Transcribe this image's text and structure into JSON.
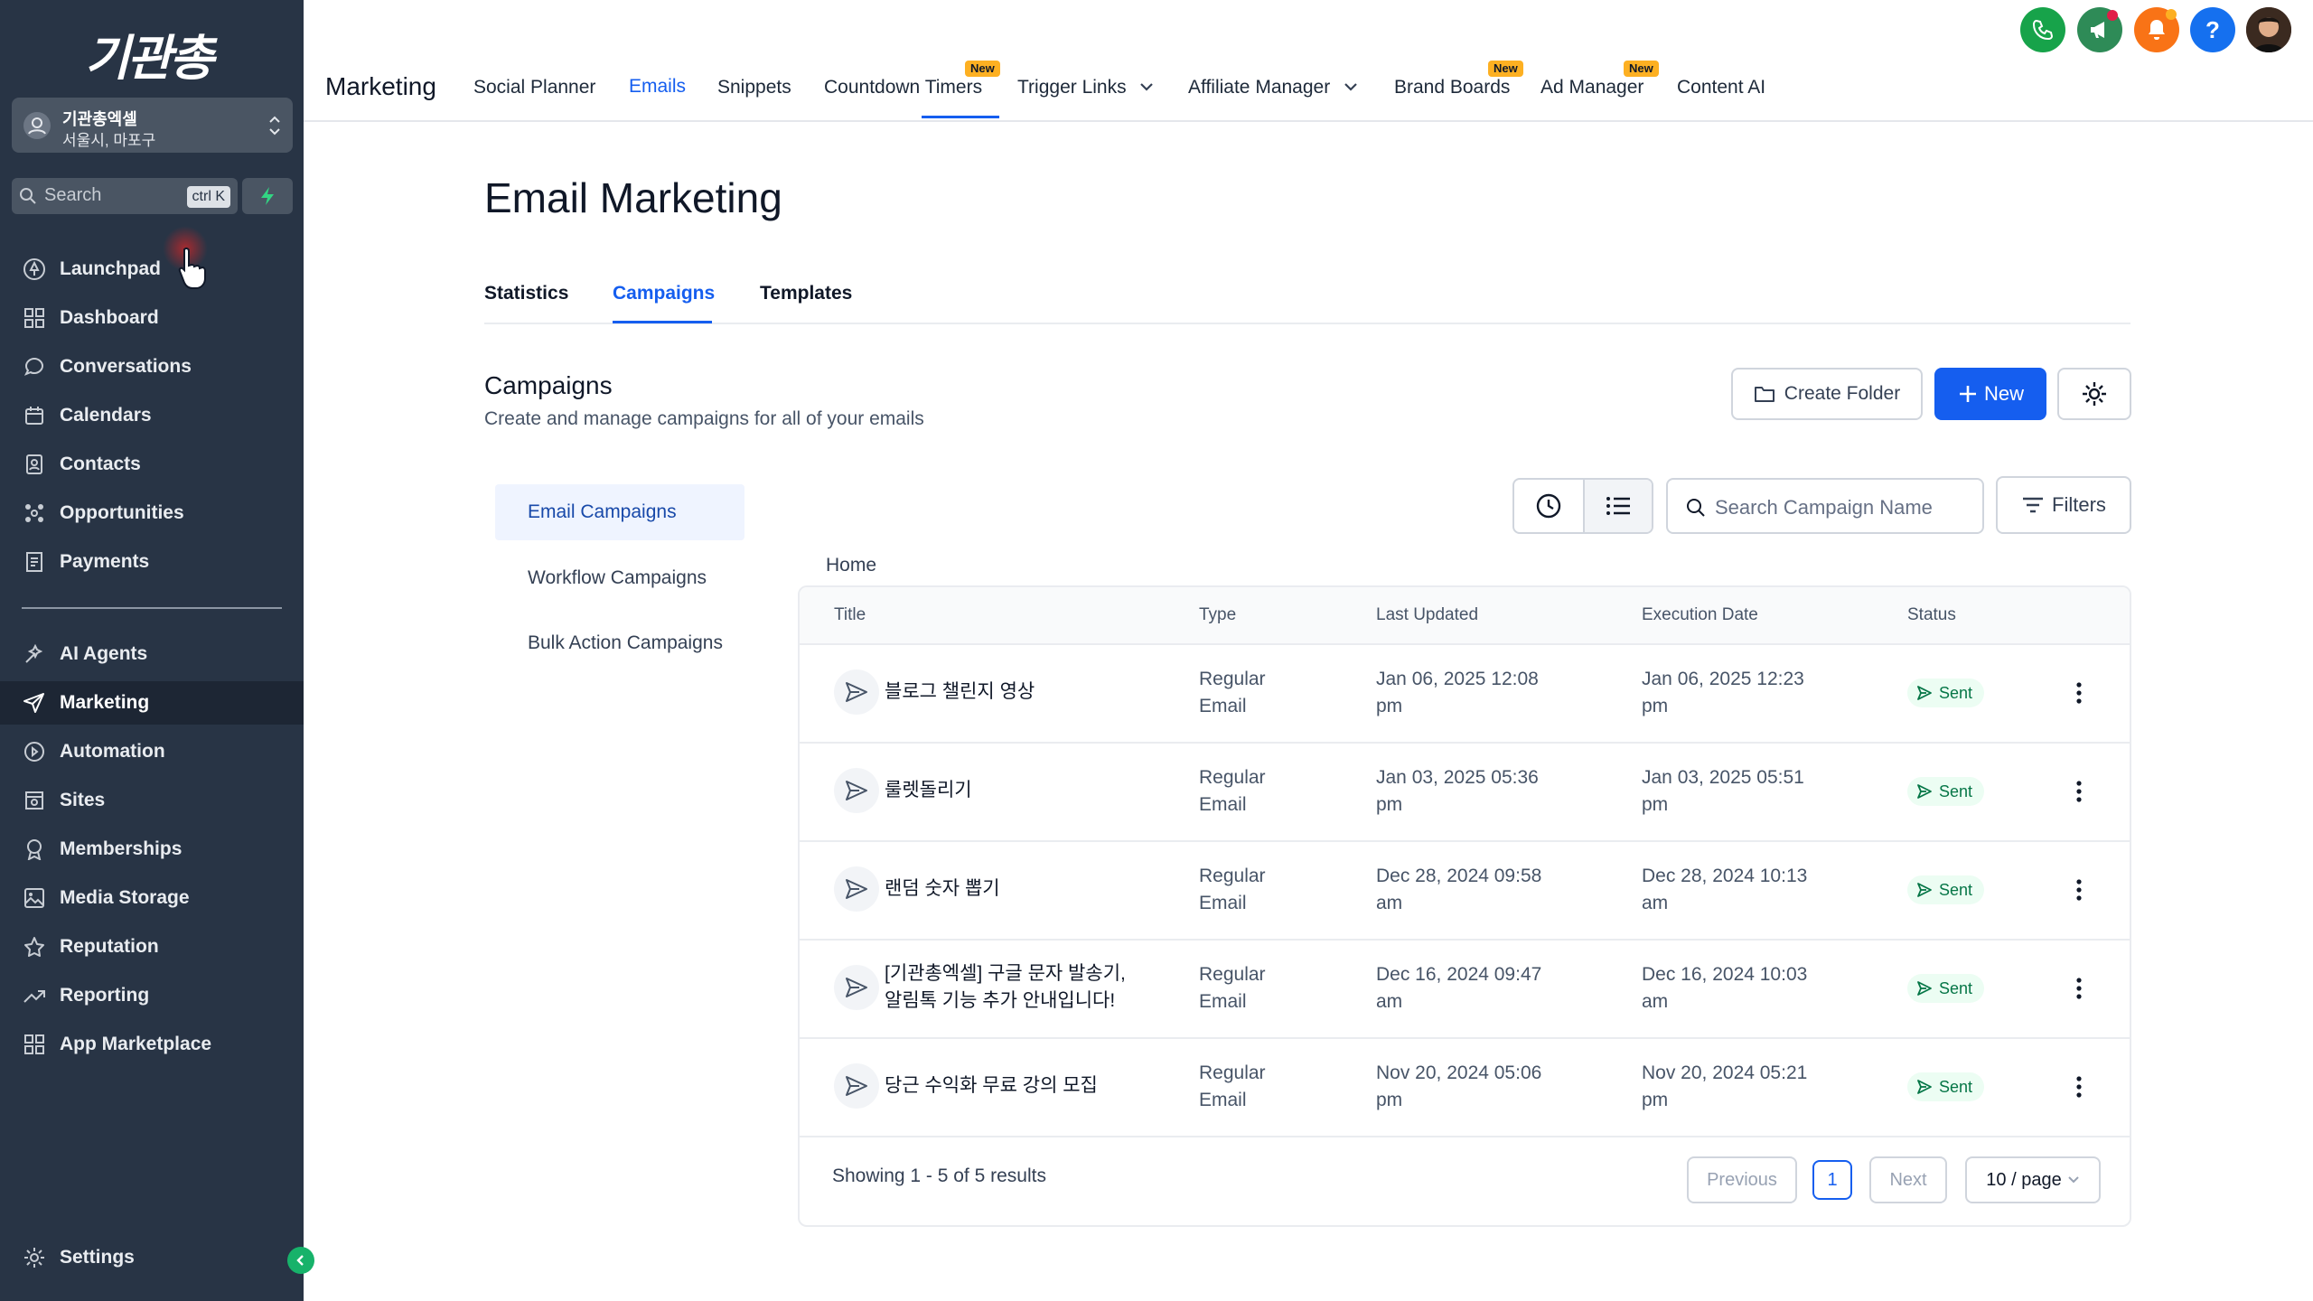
{
  "sidebar": {
    "logo": "기관총",
    "account": {
      "name": "기관총엑셀",
      "location": "서울시, 마포구"
    },
    "search": {
      "placeholder": "Search",
      "shortcut": "ctrl K"
    },
    "items_top": [
      {
        "label": "Launchpad",
        "icon": "rocket-icon"
      },
      {
        "label": "Dashboard",
        "icon": "grid-icon"
      },
      {
        "label": "Conversations",
        "icon": "chat-icon"
      },
      {
        "label": "Calendars",
        "icon": "calendar-icon"
      },
      {
        "label": "Contacts",
        "icon": "contacts-icon"
      },
      {
        "label": "Opportunities",
        "icon": "opportunities-icon"
      },
      {
        "label": "Payments",
        "icon": "payments-icon"
      }
    ],
    "items_bottom": [
      {
        "label": "AI Agents",
        "icon": "sparkle-icon"
      },
      {
        "label": "Marketing",
        "icon": "send-icon",
        "active": true
      },
      {
        "label": "Automation",
        "icon": "automation-icon"
      },
      {
        "label": "Sites",
        "icon": "sites-icon"
      },
      {
        "label": "Memberships",
        "icon": "award-icon"
      },
      {
        "label": "Media Storage",
        "icon": "image-icon"
      },
      {
        "label": "Reputation",
        "icon": "star-icon"
      },
      {
        "label": "Reporting",
        "icon": "trend-icon"
      },
      {
        "label": "App Marketplace",
        "icon": "apps-icon"
      }
    ],
    "settings": "Settings"
  },
  "topbar": {
    "app": "Marketing",
    "tabs": [
      "Social Planner",
      "Emails",
      "Snippets",
      "Countdown Timers",
      "Trigger Links",
      "Affiliate Manager",
      "Brand Boards",
      "Ad Manager",
      "Content AI"
    ],
    "active_tab": "Emails",
    "badge": "New"
  },
  "page": {
    "title": "Email Marketing",
    "subtabs": [
      "Statistics",
      "Campaigns",
      "Templates"
    ],
    "section_title": "Campaigns",
    "section_desc": "Create and manage campaigns for all of your emails",
    "create_folder": "Create Folder",
    "new": "New",
    "search_placeholder": "Search Campaign Name",
    "filters": "Filters",
    "side_nav": [
      "Email Campaigns",
      "Workflow Campaigns",
      "Bulk Action Campaigns"
    ],
    "breadcrumb": "Home"
  },
  "table": {
    "columns": [
      "Title",
      "Type",
      "Last Updated",
      "Execution Date",
      "Status"
    ],
    "rows": [
      {
        "title": "블로그 챌린지 영상",
        "title2": "",
        "type1": "Regular",
        "type2": "Email",
        "updated1": "Jan 06, 2025 12:08",
        "updated2": "pm",
        "exec1": "Jan 06, 2025 12:23",
        "exec2": "pm",
        "status": "Sent"
      },
      {
        "title": "룰렛돌리기",
        "title2": "",
        "type1": "Regular",
        "type2": "Email",
        "updated1": "Jan 03, 2025 05:36",
        "updated2": "pm",
        "exec1": "Jan 03, 2025 05:51",
        "exec2": "pm",
        "status": "Sent"
      },
      {
        "title": "랜덤 숫자 뽑기",
        "title2": "",
        "type1": "Regular",
        "type2": "Email",
        "updated1": "Dec 28, 2024 09:58",
        "updated2": "am",
        "exec1": "Dec 28, 2024 10:13",
        "exec2": "am",
        "status": "Sent"
      },
      {
        "title": "[기관총엑셀] 구글 문자 발송기,",
        "title2": "알림톡 기능 추가 안내입니다!",
        "type1": "Regular",
        "type2": "Email",
        "updated1": "Dec 16, 2024 09:47",
        "updated2": "am",
        "exec1": "Dec 16, 2024 10:03",
        "exec2": "am",
        "status": "Sent"
      },
      {
        "title": "당근 수익화 무료 강의 모집",
        "title2": "",
        "type1": "Regular",
        "type2": "Email",
        "updated1": "Nov 20, 2024 05:06",
        "updated2": "pm",
        "exec1": "Nov 20, 2024 05:21",
        "exec2": "pm",
        "status": "Sent"
      }
    ],
    "footer": "Showing 1 - 5 of 5 results",
    "prev": "Previous",
    "page": "1",
    "next": "Next",
    "per_page": "10 / page"
  },
  "colors": {
    "sidebar": "#283445",
    "accent": "#155eef",
    "success": "#067647",
    "badge": "#fdb022"
  }
}
